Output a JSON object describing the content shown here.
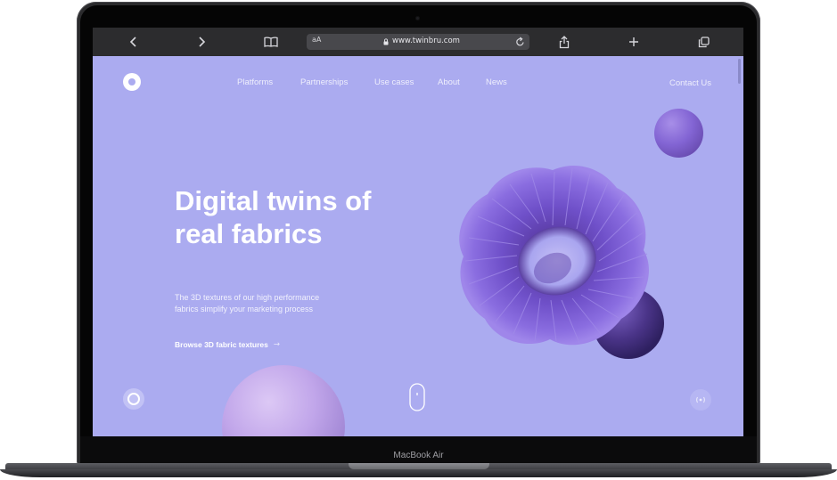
{
  "browser": {
    "reader_label": "aA",
    "url": "www.twinbru.com"
  },
  "site": {
    "nav": {
      "items": [
        {
          "label": "Platforms"
        },
        {
          "label": "Partnerships"
        },
        {
          "label": "Use cases"
        },
        {
          "label": "About"
        },
        {
          "label": "News"
        }
      ],
      "contact_label": "Contact Us"
    },
    "hero": {
      "title_line_1": "Digital twins of",
      "title_line_2": "real fabrics",
      "subtitle_line_1": "The 3D textures of our high performance",
      "subtitle_line_2": "fabrics simplify your marketing process",
      "cta_label": "Browse 3D fabric textures",
      "cta_arrow": "→"
    }
  },
  "device": {
    "model_label": "MacBook Air"
  },
  "colors": {
    "page_background": "#ababf0",
    "fabric_accent": "#7b5ed4",
    "browser_toolbar": "#2c2c2e"
  },
  "icons": {
    "toolbar": [
      "chevron-left-icon",
      "chevron-right-icon",
      "book-icon",
      "lock-icon",
      "reload-icon",
      "share-icon",
      "plus-icon",
      "tabs-icon"
    ],
    "site": [
      "logo-icon",
      "arrow-right-icon",
      "mouse-scroll-icon",
      "circle-icon",
      "sound-icon"
    ]
  }
}
